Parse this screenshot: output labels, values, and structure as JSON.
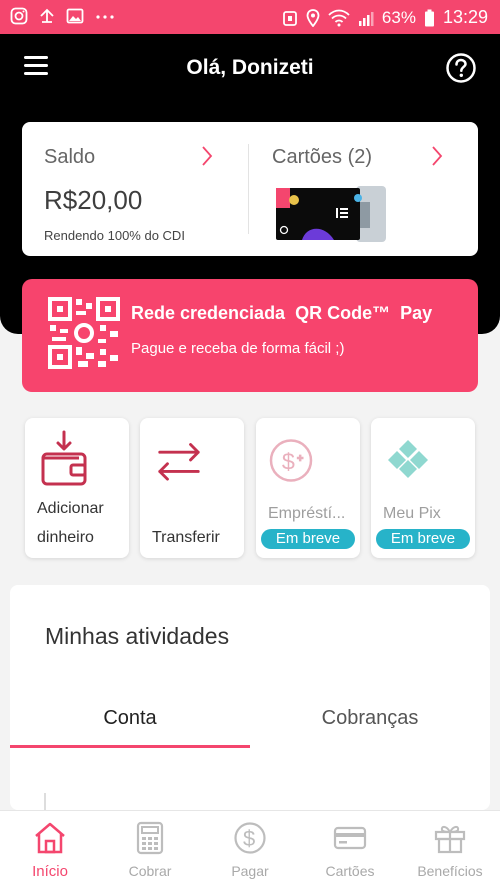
{
  "status_bar": {
    "battery_pct": "63%",
    "time": "13:29"
  },
  "header": {
    "greeting": "Olá, Donizeti"
  },
  "balance": {
    "saldo_label": "Saldo",
    "saldo_value": "R$20,00",
    "saldo_sub": "Rendendo 100% do CDI",
    "cartoes_label": "Cartões (2)"
  },
  "qr_banner": {
    "title": "Rede credenciada  QR Code™  Pay",
    "subtitle": "Pague e receba de forma fácil ;)"
  },
  "actions": [
    {
      "line1": "Adicionar",
      "line2": "dinheiro"
    },
    {
      "line1": "Transferir"
    },
    {
      "line1": "Empréstí...",
      "badge": "Em breve"
    },
    {
      "line1": "Meu Pix",
      "badge": "Em breve"
    }
  ],
  "activities": {
    "title": "Minhas atividades",
    "tabs": [
      "Conta",
      "Cobranças"
    ]
  },
  "bottom_nav": [
    "Início",
    "Cobrar",
    "Pagar",
    "Cartões",
    "Benefícios"
  ],
  "colors": {
    "accent": "#f4466e",
    "badge": "#27b3c9",
    "header": "#000000"
  }
}
